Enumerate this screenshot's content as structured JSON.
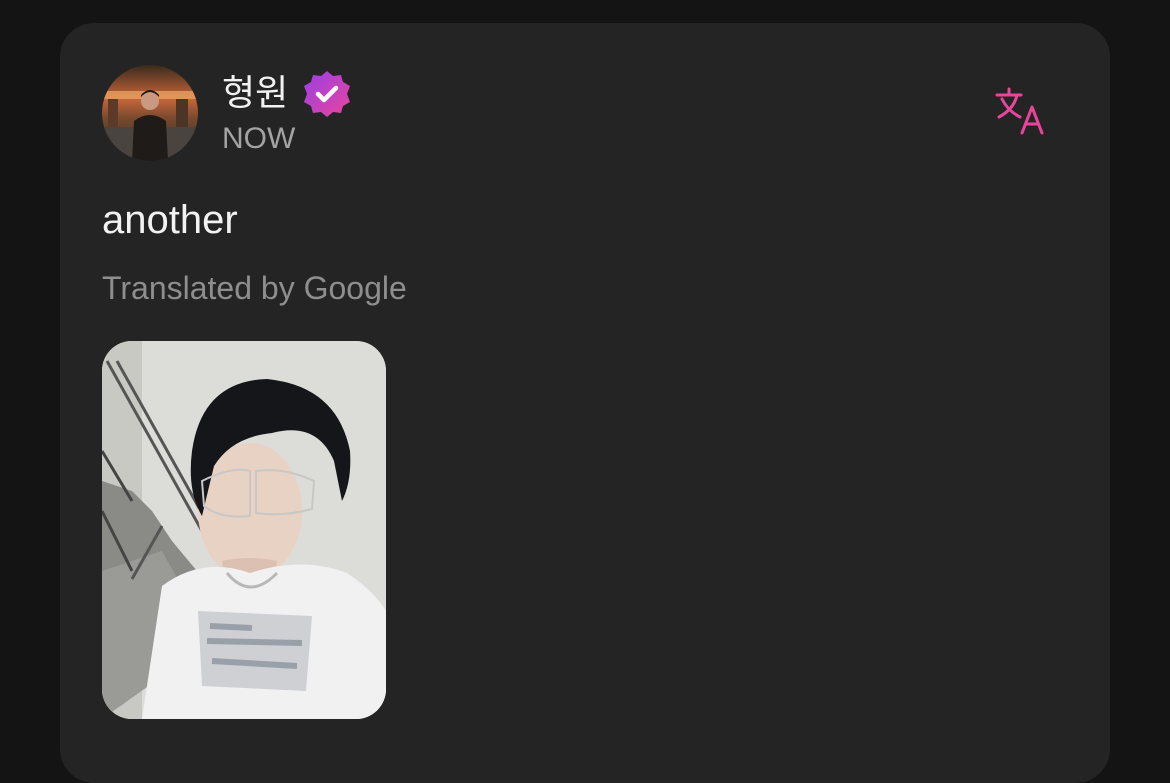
{
  "post": {
    "author_name": "형원",
    "verified": true,
    "timestamp": "NOW",
    "text": "another",
    "translation_label": "Translated by Google"
  },
  "icons": {
    "verified": "verified-badge-icon",
    "translate": "translate-icon"
  },
  "colors": {
    "background": "#141414",
    "card": "#242424",
    "accent_pink": "#e8459b",
    "accent_purple": "#b13ee0",
    "text_primary": "#f2f2f2",
    "text_secondary": "#a3a3a3",
    "text_muted": "#8e8e8e"
  }
}
